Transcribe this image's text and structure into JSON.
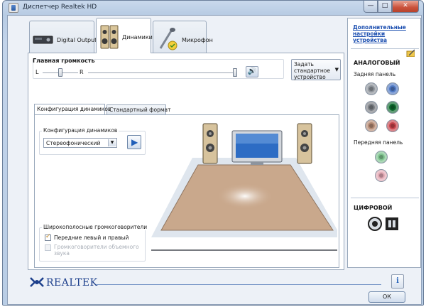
{
  "window": {
    "title": "Диспетчер Realtek HD",
    "min_glyph": "—",
    "max_glyph": "□",
    "close_glyph": "✕"
  },
  "tabs": [
    {
      "label": "Digital Output",
      "icon": "digital-output-device-icon"
    },
    {
      "label": "Динамики",
      "icon": "speakers-icon",
      "active": true
    },
    {
      "label": "Микрофон",
      "icon": "microphone-icon"
    }
  ],
  "volume": {
    "label": "Главная громкость",
    "left_label": "L",
    "right_label": "R",
    "balance": 0.5,
    "level": 1.0,
    "mute_icon": "speaker-volume-icon"
  },
  "default_device": {
    "label_line1": "Задать",
    "label_line2": "стандартное",
    "label_line3": "устройство",
    "arrow": "▼"
  },
  "inner_tabs": [
    {
      "label": "Конфигурация динамиков",
      "active": true
    },
    {
      "label": "Стандартный формат"
    }
  ],
  "speaker_config": {
    "group_label": "Конфигурация динамиков",
    "selected": "Стереофонический",
    "play_glyph": "▶"
  },
  "fullrange": {
    "group_label": "Широкополосные громкоговорители",
    "front_label": "Передние левый и правый",
    "front_checked": true,
    "surround_label_line1": "Громкоговорители объемного",
    "surround_label_line2": "звука",
    "surround_checked": false
  },
  "right_panel": {
    "advanced_link_line1": "Дополнительные",
    "advanced_link_line2": "настройки",
    "advanced_link_line3": "устройства",
    "analog_title": "АНАЛОГОВЫЙ",
    "back_panel_label": "Задняя панель",
    "front_panel_label": "Передняя панель",
    "digital_title": "ЦИФРОВОЙ",
    "back_jacks": [
      "#8e949b",
      "#4f79c4",
      "#7b7f85",
      "#0e6a2e",
      "#b58a74",
      "#c7434b"
    ],
    "front_jacks": [
      "#7fc48f",
      "#e3a9b4"
    ],
    "colors": {
      "link": "#1c4fb0"
    }
  },
  "bottom": {
    "brand": "REALTEK",
    "info_glyph": "i",
    "ok_label": "ОК"
  }
}
